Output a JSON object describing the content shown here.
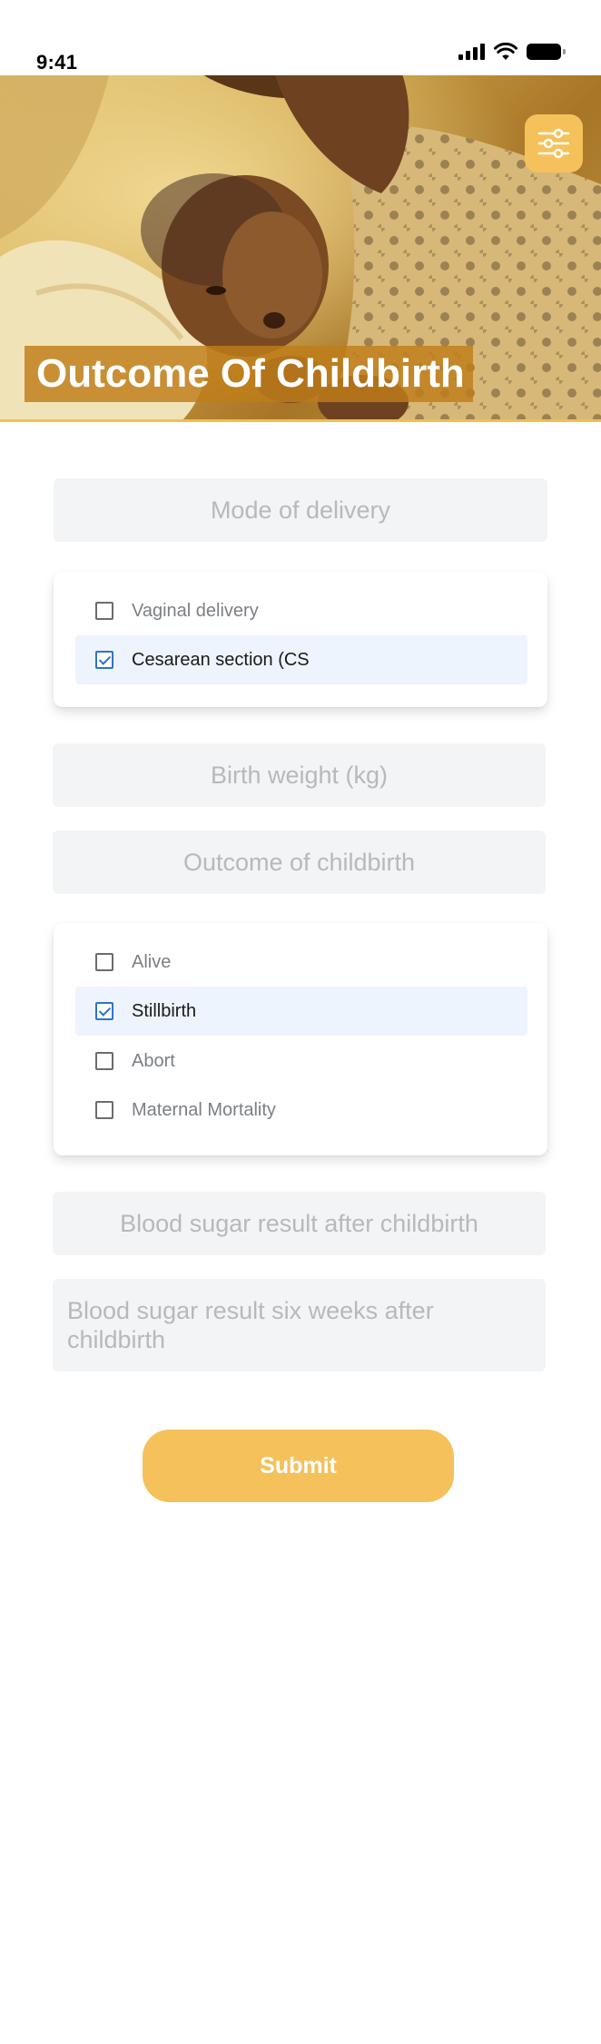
{
  "status_bar": {
    "time": "9:41"
  },
  "header": {
    "title": "Outcome Of Childbirth",
    "filter_icon": "sliders-icon"
  },
  "form": {
    "mode_of_delivery": {
      "placeholder": "Mode of delivery",
      "options": [
        {
          "label": "Vaginal delivery",
          "checked": false
        },
        {
          "label": "Cesarean section (CS",
          "checked": true
        }
      ]
    },
    "birth_weight": {
      "placeholder": "Birth weight (kg)"
    },
    "outcome_of_childbirth": {
      "placeholder": "Outcome of childbirth",
      "options": [
        {
          "label": "Alive",
          "checked": false
        },
        {
          "label": "Stillbirth",
          "checked": true
        },
        {
          "label": "Abort",
          "checked": false
        },
        {
          "label": "Maternal Mortality",
          "checked": false
        }
      ]
    },
    "blood_sugar_after": {
      "placeholder": "Blood sugar result after childbirth"
    },
    "blood_sugar_six_weeks": {
      "placeholder": "Blood sugar result six weeks after childbirth"
    },
    "submit_label": "Submit"
  },
  "colors": {
    "accent": "#f5c15a",
    "checkbox_checked": "#2f73c7",
    "selected_row": "#edf4fd"
  }
}
